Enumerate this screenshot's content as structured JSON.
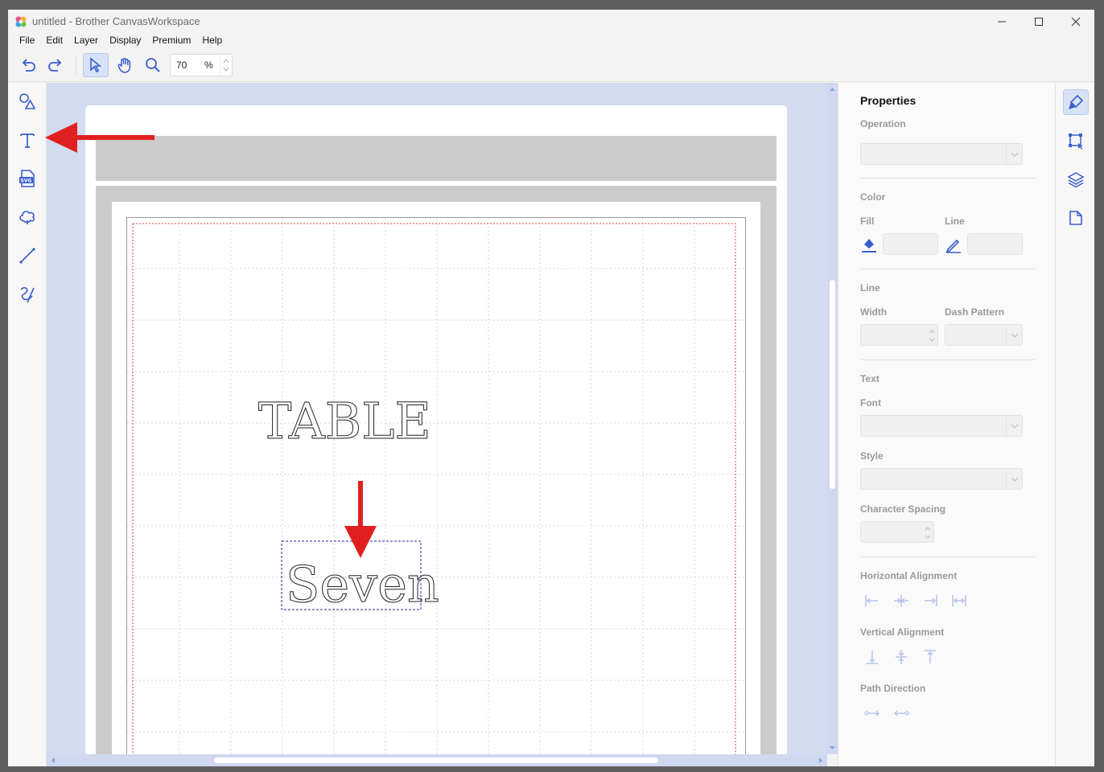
{
  "window": {
    "title": "untitled - Brother CanvasWorkspace"
  },
  "menu": [
    "File",
    "Edit",
    "Layer",
    "Display",
    "Premium",
    "Help"
  ],
  "toolbar": {
    "zoom_value": "70",
    "zoom_unit": "%",
    "tools": [
      "undo-icon",
      "redo-icon",
      "select-icon",
      "hand-icon",
      "zoom-icon"
    ]
  },
  "left_tools": [
    "shapes-icon",
    "text-icon",
    "svg-import-icon",
    "cloud-shape-icon",
    "line-icon",
    "freehand-icon"
  ],
  "canvas": {
    "texts": [
      "TABLE",
      "Seven"
    ]
  },
  "properties": {
    "title": "Properties",
    "operation_label": "Operation",
    "color_label": "Color",
    "fill_label": "Fill",
    "line_color_label": "Line",
    "line_section_label": "Line",
    "width_label": "Width",
    "dash_label": "Dash Pattern",
    "text_label": "Text",
    "font_label": "Font",
    "style_label": "Style",
    "char_spacing_label": "Character Spacing",
    "h_align_label": "Horizontal Alignment",
    "v_align_label": "Vertical Alignment",
    "path_dir_label": "Path Direction"
  },
  "right_tools": [
    "properties-paint-icon",
    "transform-icon",
    "layers-icon",
    "page-icon"
  ],
  "colors": {
    "accent": "#3a5fcd",
    "canvas_bg": "#d3dbf0",
    "annotation": "#e02020"
  }
}
